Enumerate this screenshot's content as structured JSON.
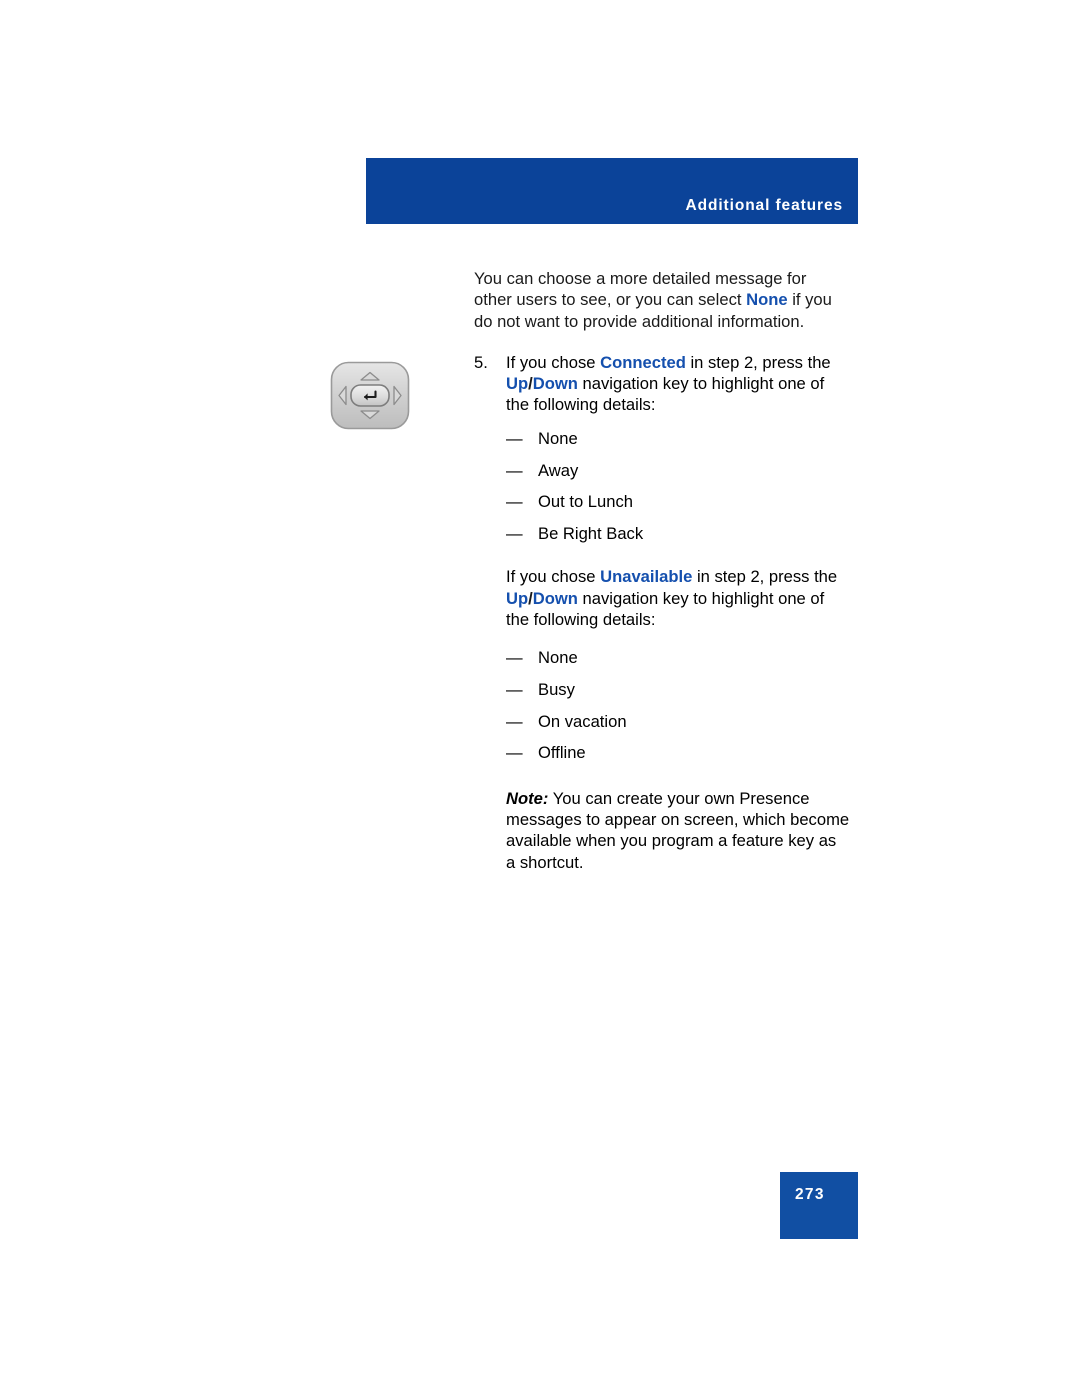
{
  "header": {
    "title": "Additional features"
  },
  "intro": {
    "text_1": "You can choose a more detailed message for other users to see, or you can select ",
    "keyword": "None",
    "text_2": " if you do not want to provide additional information."
  },
  "step": {
    "number": "5.",
    "text_1": "If you chose ",
    "keyword_1": "Connected",
    "text_2": " in step 2, press the ",
    "keyword_up": "Up",
    "slash": "/",
    "keyword_down": "Down",
    "text_3": " navigation key to highlight one of the following details:"
  },
  "connected_details": {
    "dash": "—",
    "items": [
      "None",
      "Away",
      "Out to Lunch",
      "Be Right Back"
    ]
  },
  "paragraph_unavailable": {
    "text_1": "If you chose ",
    "keyword_1": "Unavailable",
    "text_2": " in step 2, press the ",
    "keyword_up": "Up",
    "slash": "/",
    "keyword_down": "Down",
    "text_3": " navigation key to highlight one of the following details:"
  },
  "unavailable_details": {
    "dash": "—",
    "items": [
      "None",
      "Busy",
      "On vacation",
      "Offline"
    ]
  },
  "note": {
    "label": "Note:",
    "text": " You can create your own Presence messages to appear on screen, which become available when you program a feature key as a shortcut."
  },
  "figure": {
    "name": "navigation-key-cluster"
  },
  "footer": {
    "page_number": "273"
  },
  "colors": {
    "banner_blue": "#0B4399",
    "footer_blue": "#114FA3",
    "keyword_blue": "#1550AE"
  }
}
